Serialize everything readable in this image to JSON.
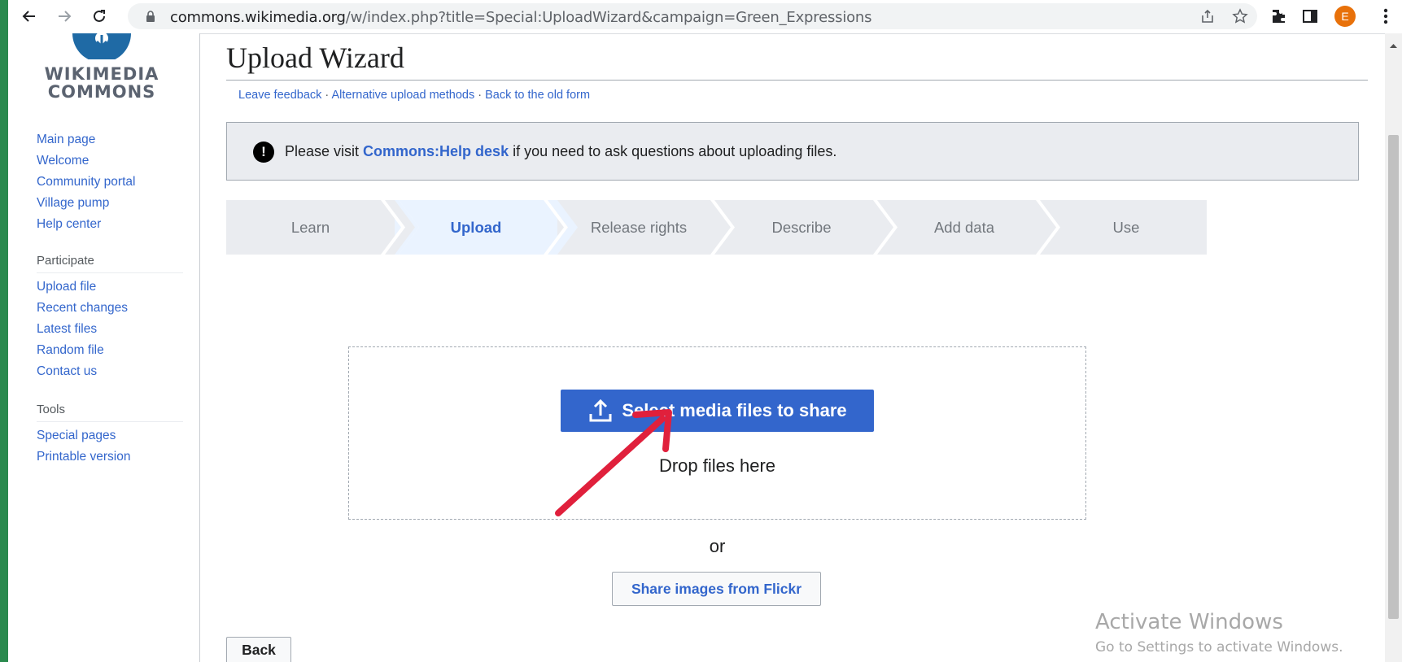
{
  "browser": {
    "url_host": "commons.wikimedia.org",
    "url_path": "/w/index.php?title=Special:UploadWizard&campaign=Green_Expressions",
    "avatar_initial": "E",
    "icons": [
      "back-icon",
      "forward-icon",
      "reload-icon",
      "lock-icon",
      "share-icon",
      "star-icon",
      "extensions-icon",
      "side-panel-icon",
      "menu-icon"
    ]
  },
  "logo": {
    "line1": "WIKIMEDIA",
    "line2": "COMMONS"
  },
  "sidebar": {
    "nav": [
      {
        "label": "Main page"
      },
      {
        "label": "Welcome"
      },
      {
        "label": "Community portal"
      },
      {
        "label": "Village pump"
      },
      {
        "label": "Help center"
      }
    ],
    "participate_heading": "Participate",
    "participate": [
      {
        "label": "Upload file"
      },
      {
        "label": "Recent changes"
      },
      {
        "label": "Latest files"
      },
      {
        "label": "Random file"
      },
      {
        "label": "Contact us"
      }
    ],
    "tools_heading": "Tools",
    "tools": [
      {
        "label": "Special pages"
      },
      {
        "label": "Printable version"
      }
    ]
  },
  "page": {
    "title": "Upload Wizard",
    "links": {
      "feedback": "Leave feedback",
      "alternative": "Alternative upload methods",
      "old_form": "Back to the old form",
      "separator": " · "
    },
    "notice": {
      "prefix": "Please visit ",
      "link": "Commons:Help desk",
      "suffix": " if you need to ask questions about uploading files."
    },
    "steps": [
      {
        "label": "Learn"
      },
      {
        "label": "Upload"
      },
      {
        "label": "Release rights"
      },
      {
        "label": "Describe"
      },
      {
        "label": "Add data"
      },
      {
        "label": "Use"
      }
    ],
    "active_step": "Upload",
    "select_button": "Select media files to share",
    "drop_text": "Drop files here",
    "or_text": "or",
    "flickr_button": "Share images from Flickr",
    "back_button": "Back"
  },
  "watermark": {
    "line1": "Activate Windows",
    "line2": "Go to Settings to activate Windows."
  },
  "colors": {
    "link": "#3366cc",
    "step_bg": "#eaecf0",
    "step_active_bg": "#eaf3ff",
    "annotation_arrow": "#e0203c"
  }
}
